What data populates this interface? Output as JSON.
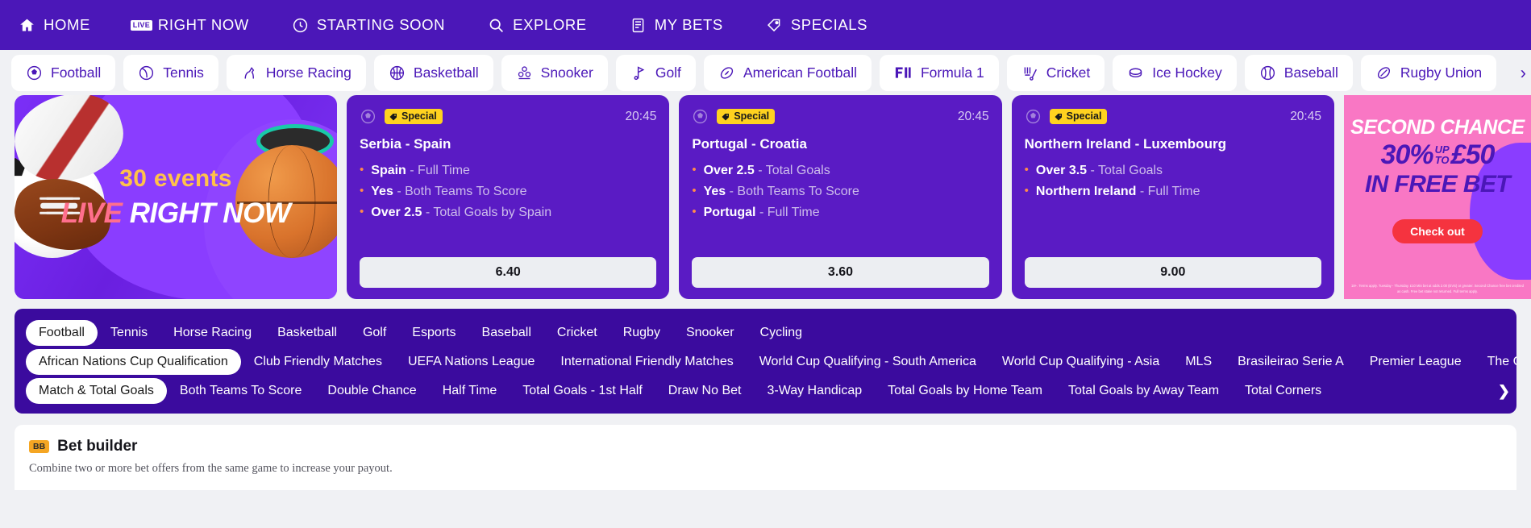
{
  "topnav": {
    "items": [
      {
        "label": "HOME",
        "icon": "home-icon"
      },
      {
        "label": "RIGHT NOW",
        "icon": "live-icon",
        "chip": "LIVE"
      },
      {
        "label": "STARTING SOON",
        "icon": "clock-icon"
      },
      {
        "label": "EXPLORE",
        "icon": "search-icon"
      },
      {
        "label": "MY BETS",
        "icon": "betslip-icon"
      },
      {
        "label": "SPECIALS",
        "icon": "tag-icon"
      }
    ]
  },
  "sportsbar": {
    "next_label": "›",
    "items": [
      {
        "label": "Football",
        "icon": "football-icon"
      },
      {
        "label": "Tennis",
        "icon": "tennis-icon"
      },
      {
        "label": "Horse Racing",
        "icon": "horse-racing-icon"
      },
      {
        "label": "Basketball",
        "icon": "basketball-icon"
      },
      {
        "label": "Snooker",
        "icon": "snooker-icon"
      },
      {
        "label": "Golf",
        "icon": "golf-icon"
      },
      {
        "label": "American Football",
        "icon": "american-football-icon"
      },
      {
        "label": "Formula 1",
        "icon": "formula1-icon"
      },
      {
        "label": "Cricket",
        "icon": "cricket-icon"
      },
      {
        "label": "Ice Hockey",
        "icon": "ice-hockey-icon"
      },
      {
        "label": "Baseball",
        "icon": "baseball-icon"
      },
      {
        "label": "Rugby Union",
        "icon": "rugby-union-icon"
      }
    ]
  },
  "live_banner": {
    "events_label": "30 events",
    "live_word": "LIVE",
    "now_words": "RIGHT NOW"
  },
  "bet_cards": [
    {
      "badge": "Special",
      "time": "20:45",
      "match": "Serbia - Spain",
      "legs": [
        {
          "pick": "Spain",
          "market": "- Full Time"
        },
        {
          "pick": "Yes",
          "market": "- Both Teams To Score"
        },
        {
          "pick": "Over 2.5",
          "market": "- Total Goals by Spain"
        }
      ],
      "odds": "6.40"
    },
    {
      "badge": "Special",
      "time": "20:45",
      "match": "Portugal - Croatia",
      "legs": [
        {
          "pick": "Over 2.5",
          "market": "- Total Goals"
        },
        {
          "pick": "Yes",
          "market": "- Both Teams To Score"
        },
        {
          "pick": "Portugal",
          "market": "- Full Time"
        }
      ],
      "odds": "3.60"
    },
    {
      "badge": "Special",
      "time": "20:45",
      "match": "Northern Ireland - Luxembourg",
      "legs": [
        {
          "pick": "Over 3.5",
          "market": "- Total Goals"
        },
        {
          "pick": "Northern Ireland",
          "market": "- Full Time"
        }
      ],
      "odds": "9.00"
    }
  ],
  "promo": {
    "line1": "SECOND CHANCE",
    "percent": "30%",
    "up": "UP",
    "to": "TO",
    "amount": "£50",
    "line3": "IN FREE BET",
    "cta": "Check out",
    "terms": "18+. Terms apply. Tuesday - Thursday. £10 Min bet at odds 2.00 (EVS) or greater. Second Chance free bet credited as cash. Free bet stake not returned. Full terms apply."
  },
  "filters": {
    "sports": {
      "next_label": "›",
      "chips": [
        "Football",
        "Tennis",
        "Horse Racing",
        "Basketball",
        "Golf",
        "Esports",
        "Baseball",
        "Cricket",
        "Rugby",
        "Snooker",
        "Cycling"
      ],
      "active": "Football"
    },
    "competitions": {
      "next_label": "❯",
      "chips": [
        "African Nations Cup Qualification",
        "Club Friendly Matches",
        "UEFA Nations League",
        "International Friendly Matches",
        "World Cup Qualifying - South America",
        "World Cup Qualifying - Asia",
        "MLS",
        "Brasileirao Serie A",
        "Premier League",
        "The Championship"
      ],
      "active": "African Nations Cup Qualification"
    },
    "markets": {
      "next_label": "›",
      "chips": [
        "Match & Total Goals",
        "Both Teams To Score",
        "Double Chance",
        "Half Time",
        "Total Goals - 1st Half",
        "Draw No Bet",
        "3-Way Handicap",
        "Total Goals by Home Team",
        "Total Goals by Away Team",
        "Total Corners"
      ],
      "active": "Match & Total Goals"
    }
  },
  "bet_builder": {
    "badge": "BB",
    "title": "Bet builder",
    "subtitle": "Combine two or more bet offers from the same game to increase your payout."
  },
  "colors": {
    "nav_purple": "#4b17b8",
    "card_purple": "#5a1bc4",
    "filter_purple": "#3b0b9e",
    "badge_yellow": "#ffd21f",
    "promo_pink": "#f977c4",
    "cta_red": "#f5333f",
    "accent_orange": "#ff8a4c"
  }
}
